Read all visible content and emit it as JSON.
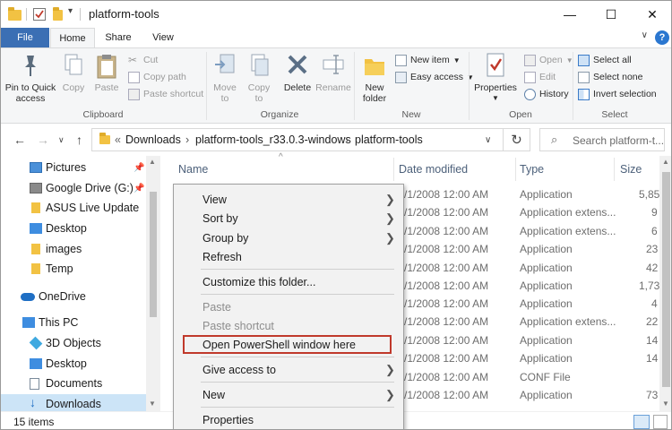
{
  "window": {
    "title": "platform-tools",
    "controls": {
      "minimize": "—",
      "maximize": "☐",
      "close": "✕"
    }
  },
  "ribbon": {
    "tabs": {
      "file": "File",
      "home": "Home",
      "share": "Share",
      "view": "View"
    },
    "help": "?",
    "clipboard": {
      "label": "Clipboard",
      "pin_line1": "Pin to Quick",
      "pin_line2": "access",
      "copy": "Copy",
      "paste": "Paste",
      "cut": "Cut",
      "copy_path": "Copy path",
      "paste_shortcut": "Paste shortcut"
    },
    "organize": {
      "label": "Organize",
      "move_line1": "Move",
      "move_line2": "to",
      "copy_line1": "Copy",
      "copy_line2": "to",
      "delete": "Delete",
      "rename": "Rename"
    },
    "new": {
      "label": "New",
      "folder_line1": "New",
      "folder_line2": "folder",
      "new_item": "New item",
      "easy_access": "Easy access"
    },
    "open": {
      "label": "Open",
      "properties": "Properties",
      "open": "Open",
      "edit": "Edit",
      "history": "History"
    },
    "select": {
      "label": "Select",
      "select_all": "Select all",
      "select_none": "Select none",
      "invert": "Invert selection"
    }
  },
  "address": {
    "overflow": "«",
    "crumbs": [
      "Downloads",
      "platform-tools_r33.0.3-windows",
      "platform-tools"
    ],
    "search_placeholder": "Search platform-t..."
  },
  "nav": {
    "items": [
      {
        "label": "Pictures",
        "pinned": true
      },
      {
        "label": "Google Drive (G:)",
        "pinned": true
      },
      {
        "label": "ASUS Live Update"
      },
      {
        "label": "Desktop"
      },
      {
        "label": "images"
      },
      {
        "label": "Temp"
      },
      {
        "label": "OneDrive"
      },
      {
        "label": "This PC"
      },
      {
        "label": "3D Objects"
      },
      {
        "label": "Desktop"
      },
      {
        "label": "Documents"
      },
      {
        "label": "Downloads",
        "selected": true
      }
    ]
  },
  "list": {
    "columns": {
      "name": "Name",
      "date": "Date modified",
      "type": "Type",
      "size": "Size"
    },
    "rows": [
      {
        "date": "/1/2008 12:00 AM",
        "type": "Application",
        "size": "5,85"
      },
      {
        "date": "/1/2008 12:00 AM",
        "type": "Application extens...",
        "size": "9"
      },
      {
        "date": "/1/2008 12:00 AM",
        "type": "Application extens...",
        "size": "6"
      },
      {
        "date": "/1/2008 12:00 AM",
        "type": "Application",
        "size": "23"
      },
      {
        "date": "/1/2008 12:00 AM",
        "type": "Application",
        "size": "42"
      },
      {
        "date": "/1/2008 12:00 AM",
        "type": "Application",
        "size": "1,73"
      },
      {
        "date": "/1/2008 12:00 AM",
        "type": "Application",
        "size": "4"
      },
      {
        "date": "/1/2008 12:00 AM",
        "type": "Application extens...",
        "size": "22"
      },
      {
        "date": "/1/2008 12:00 AM",
        "type": "Application",
        "size": "14"
      },
      {
        "date": "/1/2008 12:00 AM",
        "type": "Application",
        "size": "14"
      },
      {
        "date": "/1/2008 12:00 AM",
        "type": "CONF File",
        "size": ""
      },
      {
        "date": "/1/2008 12:00 AM",
        "type": "Application",
        "size": "73"
      }
    ]
  },
  "context_menu": {
    "view": "View",
    "sort_by": "Sort by",
    "group_by": "Group by",
    "refresh": "Refresh",
    "customize": "Customize this folder...",
    "paste": "Paste",
    "paste_shortcut": "Paste shortcut",
    "open_powershell": "Open PowerShell window here",
    "give_access": "Give access to",
    "new": "New",
    "properties": "Properties"
  },
  "status": {
    "items": "15 items"
  },
  "colors": {
    "accent": "#3b6fb4",
    "highlight_box": "#c0392b",
    "selection": "#cce4f7"
  }
}
